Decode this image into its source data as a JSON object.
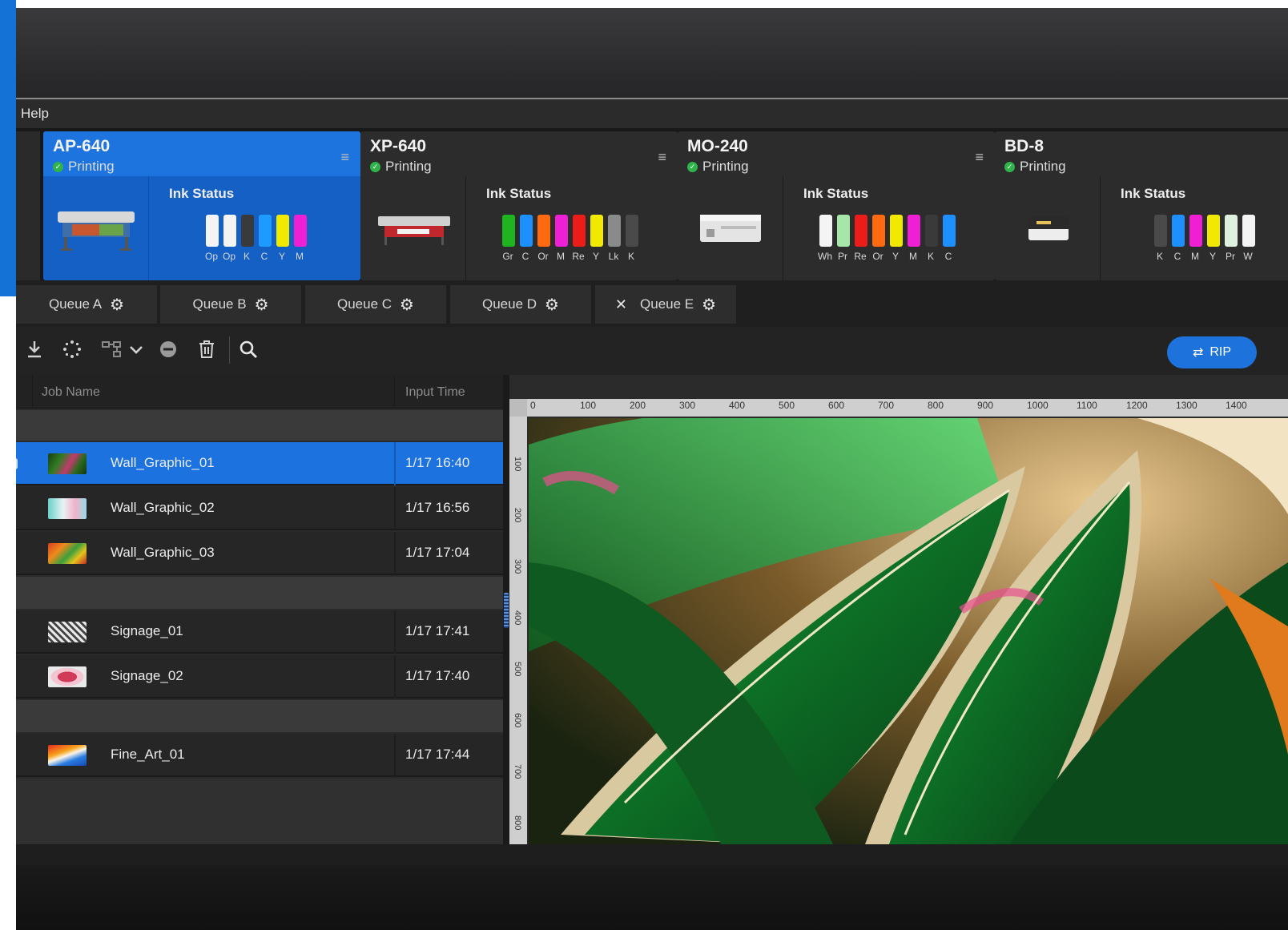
{
  "menu": {
    "help": "Help"
  },
  "printers": [
    {
      "name": "AP-640",
      "status": "Printing",
      "ink_title": "Ink Status",
      "active": true,
      "inks": [
        {
          "label": "Op",
          "color": "#f4f4f4"
        },
        {
          "label": "Op",
          "color": "#f4f4f4"
        },
        {
          "label": "K",
          "color": "#3a3a3a"
        },
        {
          "label": "C",
          "color": "#1e9bff"
        },
        {
          "label": "Y",
          "color": "#f1ea00"
        },
        {
          "label": "M",
          "color": "#ef1fd3"
        }
      ]
    },
    {
      "name": "XP-640",
      "status": "Printing",
      "ink_title": "Ink Status",
      "active": false,
      "inks": [
        {
          "label": "Gr",
          "color": "#1eb521"
        },
        {
          "label": "C",
          "color": "#1e8fff"
        },
        {
          "label": "Or",
          "color": "#ff6a10"
        },
        {
          "label": "M",
          "color": "#ef1fd3"
        },
        {
          "label": "Re",
          "color": "#ee1b1b"
        },
        {
          "label": "Y",
          "color": "#f1ea00"
        },
        {
          "label": "Lk",
          "color": "#8a8a8a"
        },
        {
          "label": "K",
          "color": "#4a4a4a"
        }
      ]
    },
    {
      "name": "MO-240",
      "status": "Printing",
      "ink_title": "Ink Status",
      "active": false,
      "inks": [
        {
          "label": "Wh",
          "color": "#f4f4f4"
        },
        {
          "label": "Pr",
          "color": "#a7e6a9"
        },
        {
          "label": "Re",
          "color": "#ee1b1b"
        },
        {
          "label": "Or",
          "color": "#ff6a10"
        },
        {
          "label": "Y",
          "color": "#f1ea00"
        },
        {
          "label": "M",
          "color": "#ef1fd3"
        },
        {
          "label": "K",
          "color": "#3a3a3a"
        },
        {
          "label": "C",
          "color": "#1e8fff"
        }
      ]
    },
    {
      "name": "BD-8",
      "status": "Printing",
      "ink_title": "Ink Status",
      "active": false,
      "inks": [
        {
          "label": "K",
          "color": "#4a4a4a"
        },
        {
          "label": "C",
          "color": "#1e8fff"
        },
        {
          "label": "M",
          "color": "#ef1fd3"
        },
        {
          "label": "Y",
          "color": "#f1ea00"
        },
        {
          "label": "Pr",
          "color": "#dff0df"
        },
        {
          "label": "W",
          "color": "#f4f4f4"
        }
      ]
    }
  ],
  "queues": [
    {
      "label": "Queue A",
      "closable": false
    },
    {
      "label": "Queue B",
      "closable": false
    },
    {
      "label": "Queue C",
      "closable": false
    },
    {
      "label": "Queue D",
      "closable": false
    },
    {
      "label": "Queue E",
      "closable": true
    }
  ],
  "toolbar": {
    "rip_label": "RIP"
  },
  "jobs_table": {
    "headers": {
      "name": "Job Name",
      "time": "Input Time"
    },
    "rows": [
      {
        "name": "Wall_Graphic_01",
        "time": "1/17 16:40",
        "selected": true
      },
      {
        "name": "Wall_Graphic_02",
        "time": "1/17 16:56",
        "selected": false
      },
      {
        "name": "Wall_Graphic_03",
        "time": "1/17 17:04",
        "selected": false
      },
      {
        "name": "Signage_01",
        "time": "1/17 17:41",
        "selected": false
      },
      {
        "name": "Signage_02",
        "time": "1/17 17:40",
        "selected": false
      },
      {
        "name": "Fine_Art_01",
        "time": "1/17 17:44",
        "selected": false
      }
    ]
  },
  "ruler": {
    "top_ticks": [
      "0",
      "100",
      "200",
      "300",
      "400",
      "500",
      "600",
      "700",
      "800",
      "900",
      "1000",
      "1100",
      "1200",
      "1300",
      "1400"
    ],
    "left_ticks": [
      "100",
      "200",
      "300",
      "400",
      "500",
      "600",
      "700",
      "800"
    ]
  },
  "colors": {
    "accent": "#1d73db",
    "status_ok": "#2fb34a"
  }
}
